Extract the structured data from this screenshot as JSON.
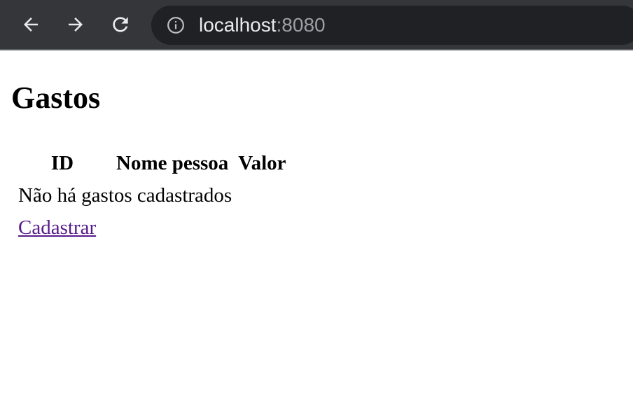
{
  "browser": {
    "url_host": "localhost",
    "url_port": ":8080",
    "icons": {
      "back": "arrow-left-icon",
      "forward": "arrow-right-icon",
      "reload": "reload-icon",
      "info": "info-icon"
    }
  },
  "page": {
    "title": "Gastos",
    "table": {
      "headers": [
        "ID",
        "Nome pessoa",
        "Valor"
      ],
      "empty_message": "Não há gastos cadastrados"
    },
    "register_link": "Cadastrar"
  },
  "colors": {
    "toolbar_bg": "#35363a",
    "omnibox_bg": "#202124",
    "visited_link": "#551a8b"
  }
}
